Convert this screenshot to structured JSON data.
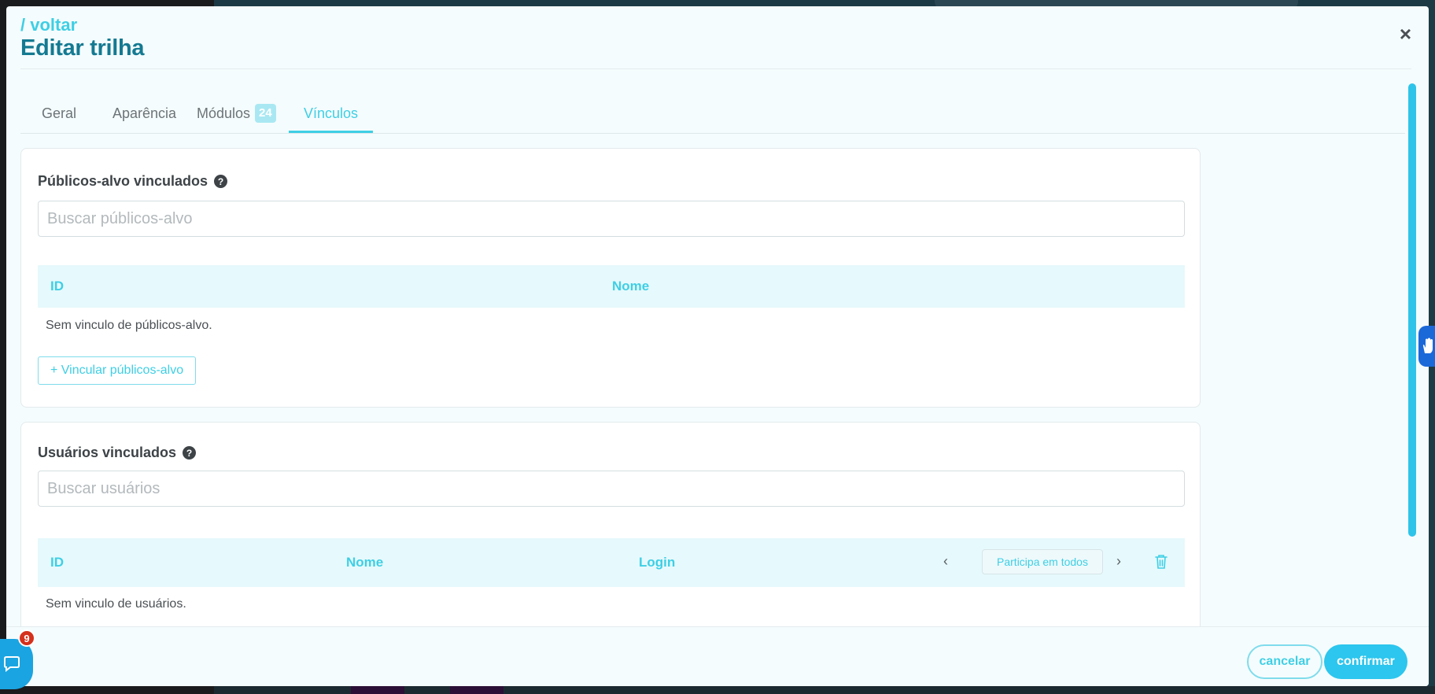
{
  "header": {
    "back_link": "/ voltar",
    "title": "Editar trilha",
    "close": "×"
  },
  "tabs": [
    {
      "label": "Geral",
      "active": false
    },
    {
      "label": "Aparência",
      "active": false
    },
    {
      "label": "Módulos",
      "badge": "24",
      "active": false
    },
    {
      "label": "Vínculos",
      "active": true
    }
  ],
  "audiences": {
    "heading": "Públicos-alvo vinculados",
    "search_placeholder": "Buscar públicos-alvo",
    "columns": [
      "ID",
      "Nome"
    ],
    "empty_text": "Sem vinculo de públicos-alvo.",
    "add_button": "+ Vincular públicos-alvo"
  },
  "users": {
    "heading": "Usuários vinculados",
    "search_placeholder": "Buscar usuários",
    "columns": [
      "ID",
      "Nome",
      "Login"
    ],
    "participates_all": "Participa em todos",
    "empty_text": "Sem vinculo de usuários."
  },
  "footer": {
    "cancel": "cancelar",
    "confirm": "confirmar"
  },
  "chat": {
    "badge_count": "9"
  },
  "colors": {
    "accent": "#3ecfe5",
    "title": "#147a92",
    "primary_button": "#2cc6ee",
    "badge_red": "#d5301b"
  }
}
